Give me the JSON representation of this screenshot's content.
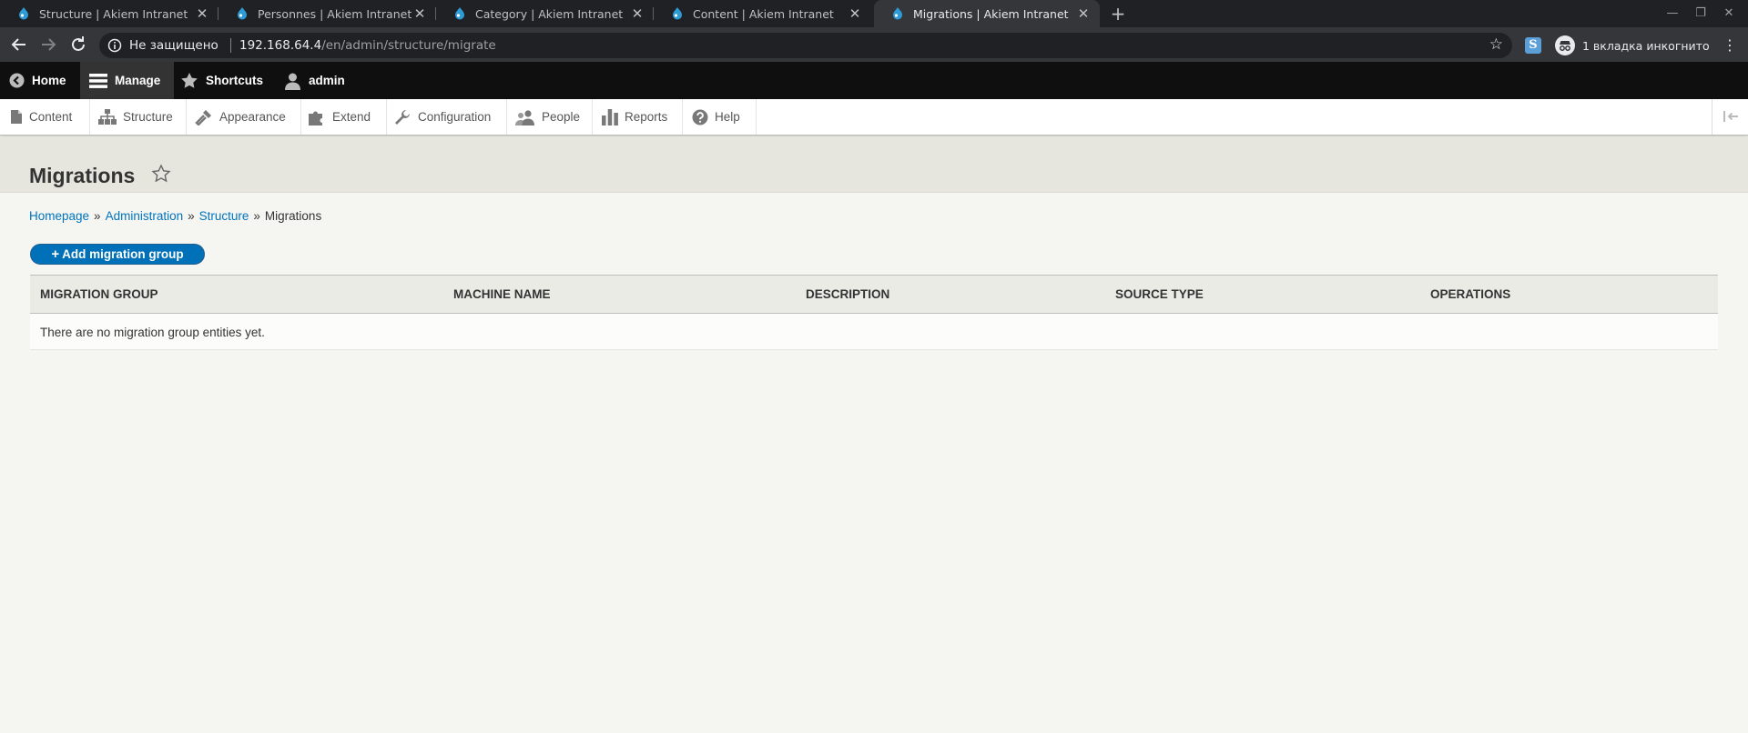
{
  "browser": {
    "tabs": [
      {
        "title": "Structure | Akiem Intranet",
        "active": false
      },
      {
        "title": "Personnes | Akiem Intranet",
        "active": false
      },
      {
        "title": "Category | Akiem Intranet",
        "active": false
      },
      {
        "title": "Content | Akiem Intranet",
        "active": false
      },
      {
        "title": "Migrations | Akiem Intranet",
        "active": true
      }
    ],
    "new_tab": "+",
    "address": {
      "security_label": "Не защищено",
      "host": "192.168.64.4",
      "path": "/en/admin/structure/migrate"
    },
    "extension_letter": "S",
    "incognito_label": "1 вкладка инкогнито"
  },
  "admin_toolbar": {
    "items": [
      {
        "label": "Home",
        "icon": "drupal-back-icon"
      },
      {
        "label": "Manage",
        "icon": "hamburger-icon"
      },
      {
        "label": "Shortcuts",
        "icon": "star-icon"
      },
      {
        "label": "admin",
        "icon": "user-icon"
      }
    ]
  },
  "tray": {
    "items": [
      {
        "label": "Content",
        "icon": "file-icon"
      },
      {
        "label": "Structure",
        "icon": "sitemap-icon"
      },
      {
        "label": "Appearance",
        "icon": "paint-icon"
      },
      {
        "label": "Extend",
        "icon": "puzzle-icon"
      },
      {
        "label": "Configuration",
        "icon": "wrench-icon"
      },
      {
        "label": "People",
        "icon": "people-icon"
      },
      {
        "label": "Reports",
        "icon": "bar-chart-icon"
      },
      {
        "label": "Help",
        "icon": "help-icon"
      }
    ]
  },
  "page": {
    "title": "Migrations",
    "breadcrumb": [
      {
        "label": "Homepage",
        "link": true
      },
      {
        "label": "Administration",
        "link": true
      },
      {
        "label": "Structure",
        "link": true
      },
      {
        "label": "Migrations",
        "link": false
      }
    ],
    "breadcrumb_separator": "»",
    "add_button": {
      "plus": "+",
      "label": "Add migration group"
    },
    "table": {
      "columns": [
        "Migration group",
        "Machine name",
        "Description",
        "Source type",
        "Operations"
      ],
      "empty_message": "There are no migration group entities yet."
    }
  },
  "colors": {
    "link": "#0074bd",
    "button": "#0071b8",
    "admin_bar": "#0f0f0f",
    "header_band": "#e6e6df"
  }
}
